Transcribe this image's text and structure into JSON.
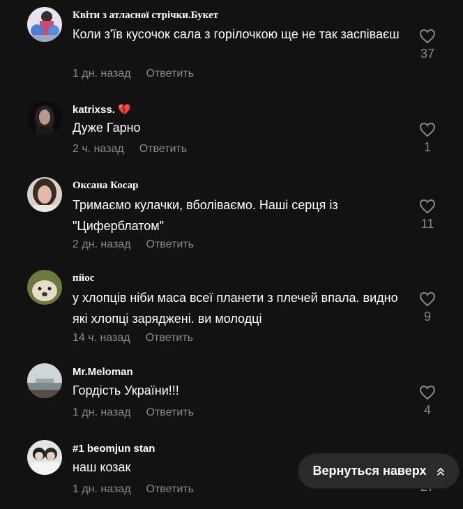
{
  "comments": [
    {
      "author": "Квіти з атласної стрічки.Букет",
      "text": "Коли з'їв кусочок сала з горілочкою ще не так заспіваєш",
      "time": "1 дн. назад",
      "reply": "Ответить",
      "likes": "37"
    },
    {
      "author": "katrixss.",
      "author_emoji": "💔",
      "text": "Дуже Гарно",
      "time": "2 ч. назад",
      "reply": "Ответить",
      "likes": "1"
    },
    {
      "author": "Оксана Косар",
      "text": "Тримаємо кулачки, вболіваємо. Наші серця із \"Циферблатом\"",
      "time": "2 дн. назад",
      "reply": "Ответить",
      "likes": "11"
    },
    {
      "author": "пйос",
      "text": "у хлопців ніби маса всеї планети з плечей впала. видно які хлопці заряджені. ви молодці",
      "time": "14 ч. назад",
      "reply": "Ответить",
      "likes": "9"
    },
    {
      "author": "Mr.Meloman",
      "text": "Гордість України!!!",
      "time": "1 дн. назад",
      "reply": "Ответить",
      "likes": "4"
    },
    {
      "author": "#1 beomjun stan",
      "text": "наш козак",
      "time": "1 дн. назад",
      "reply": "Ответить",
      "likes": "27"
    }
  ],
  "back_to_top": {
    "label": "Вернуться наверх",
    "icon": "double-chevron-up-icon"
  },
  "colors": {
    "background": "#121212",
    "muted": "#8a8a8a",
    "text": "#ffffff",
    "button": "#2a2a2a"
  }
}
